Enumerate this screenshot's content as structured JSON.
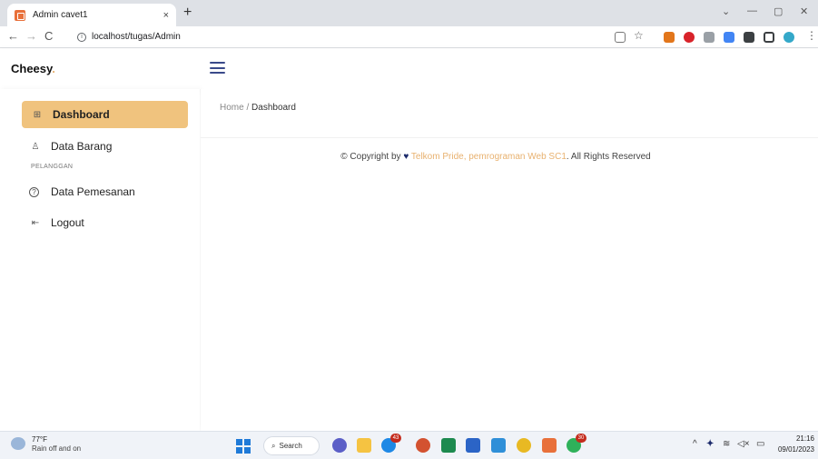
{
  "browser": {
    "tab_title": "Admin cavet1",
    "tab_close": "×",
    "new_tab": "+",
    "url": "localhost/tugas/Admin",
    "back": "←",
    "forward": "→",
    "reload": "C",
    "win_min": "—",
    "win_max": "▢",
    "win_close": "✕",
    "win_chevron": "⌄"
  },
  "app": {
    "brand": "Cheesy",
    "brand_dot": ".",
    "accent_color": "#f0c37e"
  },
  "sidebar": {
    "items": [
      {
        "label": "Dashboard",
        "icon": "grid-icon",
        "glyph": "⊞"
      },
      {
        "label": "Data Barang",
        "icon": "user-icon",
        "glyph": "♙"
      },
      {
        "label": "Data Pemesanan",
        "icon": "help-circle-icon",
        "glyph": "?"
      },
      {
        "label": "Logout",
        "icon": "logout-icon",
        "glyph": "⇤"
      }
    ],
    "heading": "PELANGGAN"
  },
  "main": {
    "breadcrumb_home": "Home",
    "breadcrumb_sep": "/",
    "breadcrumb_current": "Dashboard",
    "footer_prefix": "© Copyright by",
    "footer_heart": "♥",
    "footer_link": "Telkom Pride, pemrograman Web SC1",
    "footer_suffix": ". All Rights Reserved"
  },
  "taskbar": {
    "weather_temp": "77°F",
    "weather_desc": "Rain off and on",
    "search_label": "Search",
    "badge_edge": "43",
    "badge_chrome": "30",
    "time": "21:16",
    "date": "09/01/2023",
    "tray_chevron": "^",
    "tray_wifi": "≋",
    "tray_volume": "◁×"
  }
}
